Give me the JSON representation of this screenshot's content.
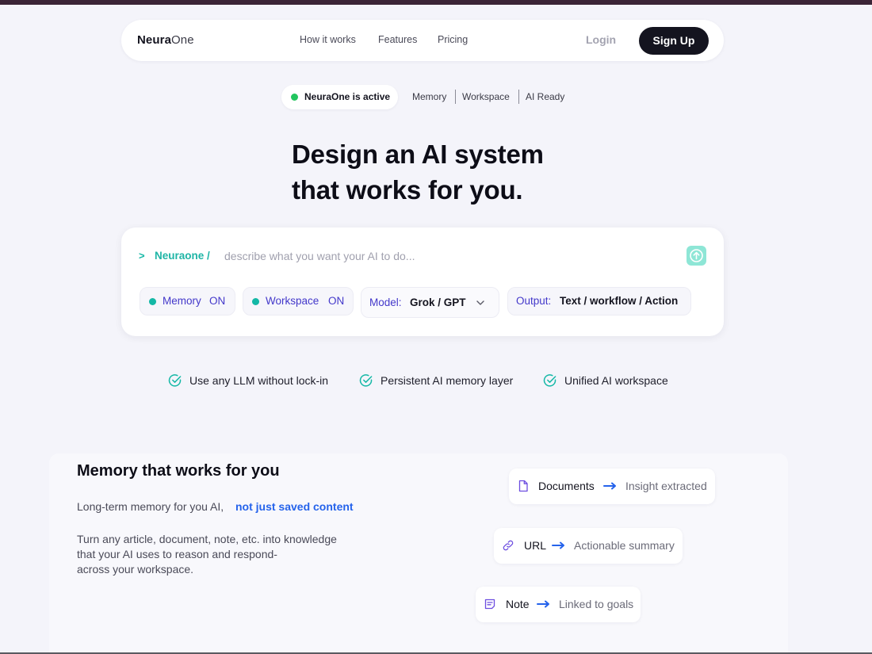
{
  "nav": {
    "brand_bold": "Neura",
    "brand_light": "One",
    "links": [
      "How it works",
      "Features",
      "Pricing"
    ],
    "login": "Login",
    "signup": "Sign Up"
  },
  "status": {
    "active_label": "NeuraOne is active",
    "tags": [
      "Memory",
      "Workspace",
      "AI Ready"
    ]
  },
  "hero": {
    "line1": "Design an AI system",
    "line2": "that works for you."
  },
  "prompt": {
    "caret": ">",
    "prefix": "Neuraone /",
    "placeholder": "describe what you want your AI to do...",
    "value": ""
  },
  "chips": {
    "memory_label": "Memory",
    "memory_state": "ON",
    "workspace_label": "Workspace",
    "workspace_state": "ON",
    "model_label": "Model:",
    "model_value": "Grok / GPT",
    "output_label": "Output:",
    "output_value": "Text / workflow / Action"
  },
  "features": [
    "Use any LLM without lock-in",
    "Persistent AI memory layer",
    "Unified AI workspace"
  ],
  "memory": {
    "title": "Memory that works for you",
    "subtitle": "Long-term memory for you AI,",
    "subtitle_link": "not just saved content",
    "body": [
      "Turn any article, document, note, etc. into knowledge",
      "that your AI uses to reason and respond-",
      "across your workspace."
    ],
    "flows": [
      {
        "from": "Documents",
        "to": "Insight extracted",
        "icon": "document-icon"
      },
      {
        "from": "URL",
        "to": "Actionable summary",
        "icon": "link-icon"
      },
      {
        "from": "Note",
        "to": "Linked to goals",
        "icon": "note-icon"
      }
    ]
  },
  "colors": {
    "accent_teal": "#14b8a6",
    "accent_indigo": "#4338ca",
    "link_blue": "#2563eb",
    "status_green": "#22c55e",
    "dark": "#14141f"
  }
}
